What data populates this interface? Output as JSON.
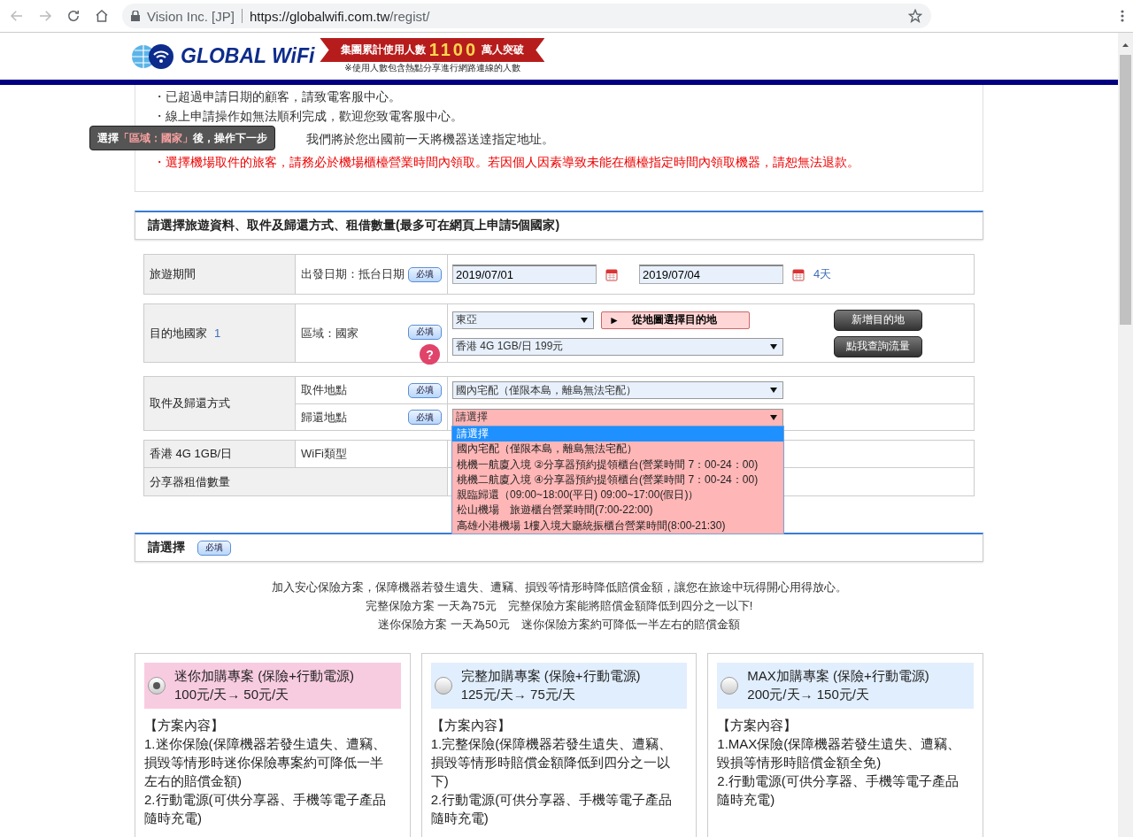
{
  "browser": {
    "site_label": "Vision Inc. [JP]",
    "url_host": "https://globalwifi.com.tw",
    "url_path": "/regist/"
  },
  "header": {
    "logo": "GLOBAL WiFi",
    "banner_prefix": "集團累計使用人數",
    "banner_number": "1100",
    "banner_suffix": "萬人突破",
    "banner_note": "※使用人數包含熱點分享進行網路連線的人數"
  },
  "notices": [
    {
      "kind": "normal",
      "text": "・已超過申請日期的顧客，請致電客服中心。"
    },
    {
      "kind": "normal",
      "text": "・線上申請操作如無法順利完成，歡迎您致電客服中心。"
    },
    {
      "kind": "normal",
      "text": "我們將於您出國前一天將機器送達指定地址。"
    },
    {
      "kind": "warning",
      "text": "・選擇機場取件的旅客，請務必於機場櫃檯營業時間內領取。若因個人因素導致未能在櫃檯指定時間內領取機器，請恕無法退款。"
    }
  ],
  "tooltip": {
    "prefix": "選擇",
    "highlight": "「區域：國家」",
    "suffix": "後，操作下一步"
  },
  "travel_section": {
    "title": "請選擇旅遊資料、取件及歸還方式、租借數量(最多可在網頁上申請5個國家)"
  },
  "period": {
    "label": "旅遊期間",
    "sublabel": "出發日期：抵台日期",
    "required": "必填",
    "start": "2019/07/01",
    "end": "2019/07/04",
    "days": "4天"
  },
  "destination": {
    "label": "目的地國家",
    "index": "1",
    "sublabel": "區域：國家",
    "required": "必填",
    "help": "?",
    "region": "東亞",
    "map_button": "從地圖選擇目的地",
    "map_arrow": "►",
    "plan": "香港 4G 1GB/日 199元",
    "add_button": "新增目的地",
    "usage_button": "點我查詢流量"
  },
  "delivery": {
    "label": "取件及歸還方式",
    "pickup_label": "取件地點",
    "pickup_required": "必填",
    "pickup_value": "國內宅配（僅限本島，離島無法宅配）",
    "return_label": "歸還地點",
    "return_required": "必填",
    "return_value": "請選擇",
    "return_open": true,
    "return_options": [
      {
        "label": "請選擇",
        "selected": true
      },
      {
        "label": "國內宅配（僅限本島，離島無法宅配）",
        "selected": false
      },
      {
        "label": "桃機一航廈入境 ②分享器預約提領櫃台(營業時間 7：00-24：00)",
        "selected": false
      },
      {
        "label": "桃機二航廈入境 ④分享器預約提領櫃台(營業時間 7：00-24：00)",
        "selected": false
      },
      {
        "label": "親臨歸還（09:00~18:00(平日) 09:00~17:00(假日)）",
        "selected": false
      },
      {
        "label": "松山機場　旅遊櫃台營業時間(7:00-22:00)",
        "selected": false
      },
      {
        "label": "高雄小港機場 1樓入境大廳統振櫃台營業時間(8:00-21:30)",
        "selected": false
      }
    ]
  },
  "device": {
    "label": "香港 4G 1GB/日",
    "type_label": "WiFi類型",
    "quantity_label": "分享器租借數量"
  },
  "insurance_section": {
    "title": "請選擇",
    "required": "必填"
  },
  "insurance_intro": [
    "加入安心保險方案，保障機器若發生遺失、遭竊、損毀等情形時降低賠償金額，讓您在旅途中玩得開心用得放心。",
    "完整保險方案 一天為75元　完整保險方案能將賠償金額降低到四分之一以下!",
    "迷你保險方案 一天為50元　迷你保險方案約可降低一半左右的賠償金額"
  ],
  "plans": [
    {
      "selected": true,
      "title": "迷你加購專案 (保險+行動電源)",
      "price": "100元/天→ 50元/天",
      "heading": "【方案內容】",
      "items": [
        "1.迷你保險(保障機器若發生遺失、遭竊、損毀等情形時迷你保險專案約可降低一半左右的賠償金額)",
        "2.行動電源(可供分享器、手機等電子產品隨時充電)"
      ]
    },
    {
      "selected": false,
      "title": "完整加購專案 (保險+行動電源)",
      "price": "125元/天→ 75元/天",
      "heading": "【方案內容】",
      "items": [
        "1.完整保險(保障機器若發生遺失、遭竊、損毀等情形時賠償金額降低到四分之一以下)",
        "2.行動電源(可供分享器、手機等電子產品隨時充電)"
      ]
    },
    {
      "selected": false,
      "title": "MAX加購專案 (保險+行動電源)",
      "price": "200元/天→ 150元/天",
      "heading": "【方案內容】",
      "items": [
        "1.MAX保險(保障機器若發生遺失、遭竊、毀損等情形時賠償金額全免)",
        "2.行動電源(可供分享器、手機等電子產品隨時充電)"
      ]
    }
  ]
}
